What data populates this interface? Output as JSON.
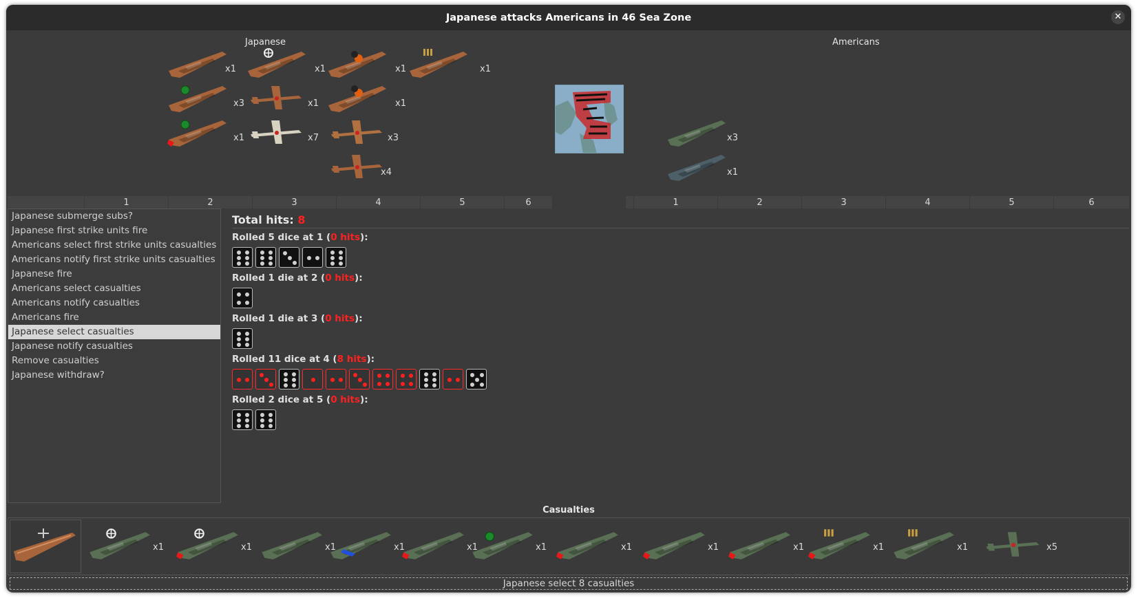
{
  "window": {
    "title": "Japanese attacks Americans in 46 Sea Zone",
    "close_icon": "close-icon"
  },
  "sides": {
    "attacker": "Japanese",
    "defender": "Americans"
  },
  "colors": {
    "japanese_unit": "#a8643a",
    "american_unit": "#5a7055",
    "hit_red": "#ff2020",
    "selected_row": "#d7d7d7"
  },
  "attacker_units": [
    {
      "icon": "submarine-icon",
      "count": "x1"
    },
    {
      "icon": "battleship-icon",
      "count": "x3"
    },
    {
      "icon": "battleship-damaged-icon",
      "count": "x1"
    },
    {
      "icon": "carrier-icon",
      "count": "x1"
    },
    {
      "icon": "fighter-icon",
      "count": "x1"
    },
    {
      "icon": "fighter-white-icon",
      "count": "x7"
    },
    {
      "icon": "burning-cruiser-icon",
      "count": "x1"
    },
    {
      "icon": "burning-destroyer-icon",
      "count": "x1"
    },
    {
      "icon": "fighter-brown-icon",
      "count": "x3"
    },
    {
      "icon": "bomber-icon",
      "count": "x4"
    },
    {
      "icon": "battleship-ammo-icon",
      "count": "x1"
    }
  ],
  "defender_units": [
    {
      "icon": "transport-icon",
      "count": "x3"
    },
    {
      "icon": "destroyer-icon",
      "count": "x1"
    }
  ],
  "attacker_columns": [
    "",
    "1",
    "2",
    "3",
    "4",
    "5",
    "6"
  ],
  "defender_columns": [
    "",
    "1",
    "2",
    "3",
    "4",
    "5",
    "6"
  ],
  "steps": [
    "Japanese submerge subs?",
    "Japanese first strike units fire",
    "Americans select first strike units casualties",
    "Americans notify first strike units casualties",
    "Japanese fire",
    "Americans select casualties",
    "Americans notify casualties",
    "Americans fire",
    "Japanese select casualties",
    "Japanese notify casualties",
    "Remove casualties",
    "Japanese withdraw?"
  ],
  "selected_step": 8,
  "dice": {
    "total_label": "Total hits:",
    "total_value": "8",
    "rolls": [
      {
        "prefix": "Rolled 5 dice at 1 (",
        "hits": "0 hits",
        "suffix": "):",
        "dice": [
          {
            "v": 6,
            "hit": false
          },
          {
            "v": 6,
            "hit": false
          },
          {
            "v": 3,
            "hit": false
          },
          {
            "v": 2,
            "hit": false
          },
          {
            "v": 6,
            "hit": false
          }
        ]
      },
      {
        "prefix": "Rolled 1 die at 2 (",
        "hits": "0 hits",
        "suffix": "):",
        "dice": [
          {
            "v": 4,
            "hit": false
          }
        ]
      },
      {
        "prefix": "Rolled 1 die at 3 (",
        "hits": "0 hits",
        "suffix": "):",
        "dice": [
          {
            "v": 6,
            "hit": false
          }
        ]
      },
      {
        "prefix": "Rolled 11 dice at 4 (",
        "hits": "8 hits",
        "suffix": "):",
        "dice": [
          {
            "v": 2,
            "hit": true
          },
          {
            "v": 3,
            "hit": true
          },
          {
            "v": 6,
            "hit": false
          },
          {
            "v": 1,
            "hit": true
          },
          {
            "v": 2,
            "hit": true
          },
          {
            "v": 3,
            "hit": true
          },
          {
            "v": 4,
            "hit": true
          },
          {
            "v": 4,
            "hit": true
          },
          {
            "v": 6,
            "hit": false
          },
          {
            "v": 2,
            "hit": true
          },
          {
            "v": 5,
            "hit": false
          }
        ]
      },
      {
        "prefix": "Rolled 2 dice at 5 (",
        "hits": "0 hits",
        "suffix": "):",
        "dice": [
          {
            "v": 6,
            "hit": false
          },
          {
            "v": 6,
            "hit": false
          }
        ]
      }
    ]
  },
  "casualties": {
    "header": "Casualties",
    "selected_icon": "carrier-icon",
    "items": [
      {
        "icon": "carrier-icon",
        "count": "x1"
      },
      {
        "icon": "carrier-damaged-icon",
        "count": "x1"
      },
      {
        "icon": "transport-icon",
        "count": "x1"
      },
      {
        "icon": "submarine-icon",
        "count": "x1"
      },
      {
        "icon": "destroyer-damaged-icon",
        "count": "x1"
      },
      {
        "icon": "battleship-icon",
        "count": "x1"
      },
      {
        "icon": "cruiser-damaged-icon",
        "count": "x1"
      },
      {
        "icon": "carrier-red-icon",
        "count": "x1"
      },
      {
        "icon": "destroyer-damaged-icon",
        "count": "x1"
      },
      {
        "icon": "battleship-ammo-damaged-icon",
        "count": "x1"
      },
      {
        "icon": "battleship-ammo-icon",
        "count": "x1"
      },
      {
        "icon": "fighter-icon",
        "count": "x5"
      }
    ]
  },
  "status": "Japanese select 8 casualties"
}
